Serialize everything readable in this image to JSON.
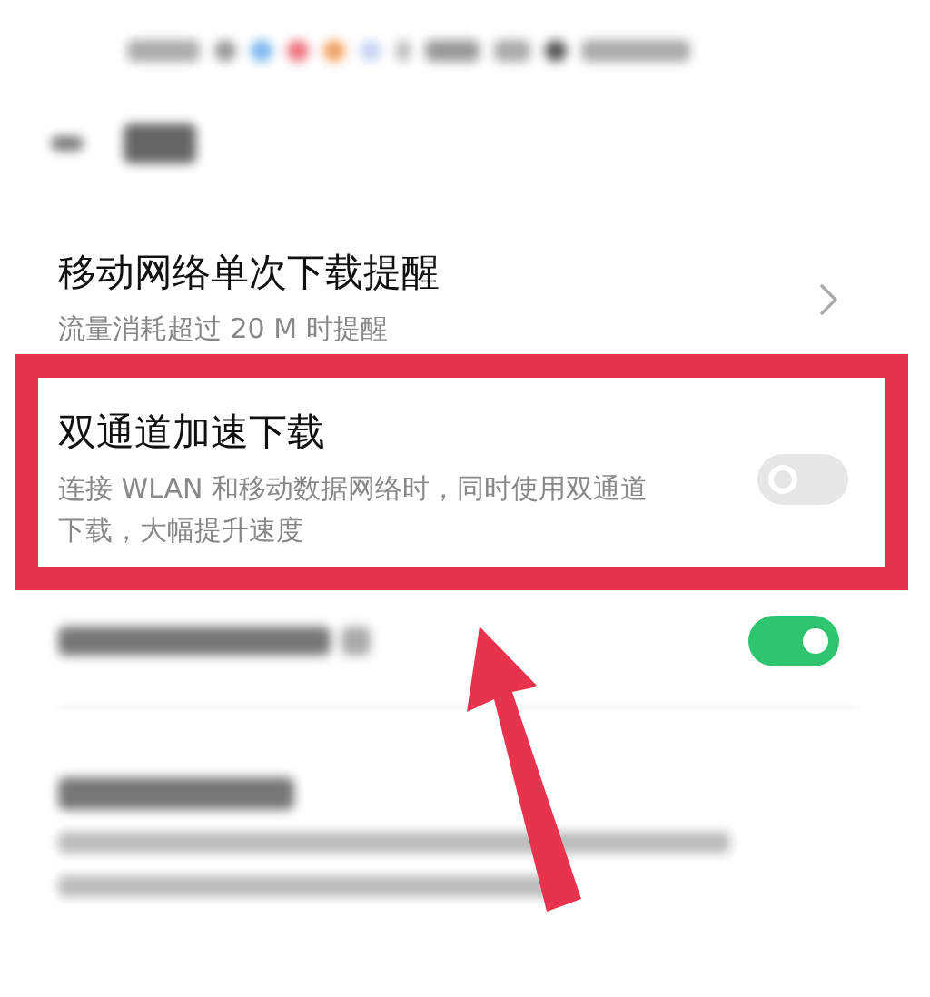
{
  "settings": [
    {
      "kind": "link",
      "title": "移动网络单次下载提醒",
      "subtitle": "流量消耗超过 20 M 时提醒"
    },
    {
      "kind": "toggle",
      "title": "双通道加速下载",
      "subtitle": "连接 WLAN 和移动数据网络时，同时使用双通道下载，大幅提升速度",
      "on": false,
      "highlighted": true
    },
    {
      "kind": "toggle",
      "on": true
    }
  ]
}
